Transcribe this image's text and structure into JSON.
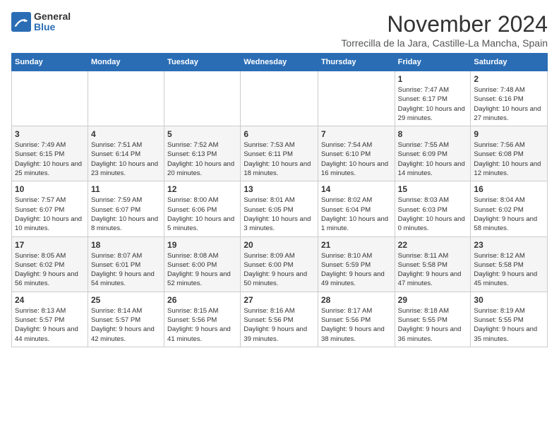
{
  "logo": {
    "general": "General",
    "blue": "Blue"
  },
  "title": "November 2024",
  "subtitle": "Torrecilla de la Jara, Castille-La Mancha, Spain",
  "days_of_week": [
    "Sunday",
    "Monday",
    "Tuesday",
    "Wednesday",
    "Thursday",
    "Friday",
    "Saturday"
  ],
  "weeks": [
    [
      {
        "day": "",
        "info": ""
      },
      {
        "day": "",
        "info": ""
      },
      {
        "day": "",
        "info": ""
      },
      {
        "day": "",
        "info": ""
      },
      {
        "day": "",
        "info": ""
      },
      {
        "day": "1",
        "info": "Sunrise: 7:47 AM\nSunset: 6:17 PM\nDaylight: 10 hours and 29 minutes."
      },
      {
        "day": "2",
        "info": "Sunrise: 7:48 AM\nSunset: 6:16 PM\nDaylight: 10 hours and 27 minutes."
      }
    ],
    [
      {
        "day": "3",
        "info": "Sunrise: 7:49 AM\nSunset: 6:15 PM\nDaylight: 10 hours and 25 minutes."
      },
      {
        "day": "4",
        "info": "Sunrise: 7:51 AM\nSunset: 6:14 PM\nDaylight: 10 hours and 23 minutes."
      },
      {
        "day": "5",
        "info": "Sunrise: 7:52 AM\nSunset: 6:13 PM\nDaylight: 10 hours and 20 minutes."
      },
      {
        "day": "6",
        "info": "Sunrise: 7:53 AM\nSunset: 6:11 PM\nDaylight: 10 hours and 18 minutes."
      },
      {
        "day": "7",
        "info": "Sunrise: 7:54 AM\nSunset: 6:10 PM\nDaylight: 10 hours and 16 minutes."
      },
      {
        "day": "8",
        "info": "Sunrise: 7:55 AM\nSunset: 6:09 PM\nDaylight: 10 hours and 14 minutes."
      },
      {
        "day": "9",
        "info": "Sunrise: 7:56 AM\nSunset: 6:08 PM\nDaylight: 10 hours and 12 minutes."
      }
    ],
    [
      {
        "day": "10",
        "info": "Sunrise: 7:57 AM\nSunset: 6:07 PM\nDaylight: 10 hours and 10 minutes."
      },
      {
        "day": "11",
        "info": "Sunrise: 7:59 AM\nSunset: 6:07 PM\nDaylight: 10 hours and 8 minutes."
      },
      {
        "day": "12",
        "info": "Sunrise: 8:00 AM\nSunset: 6:06 PM\nDaylight: 10 hours and 5 minutes."
      },
      {
        "day": "13",
        "info": "Sunrise: 8:01 AM\nSunset: 6:05 PM\nDaylight: 10 hours and 3 minutes."
      },
      {
        "day": "14",
        "info": "Sunrise: 8:02 AM\nSunset: 6:04 PM\nDaylight: 10 hours and 1 minute."
      },
      {
        "day": "15",
        "info": "Sunrise: 8:03 AM\nSunset: 6:03 PM\nDaylight: 10 hours and 0 minutes."
      },
      {
        "day": "16",
        "info": "Sunrise: 8:04 AM\nSunset: 6:02 PM\nDaylight: 9 hours and 58 minutes."
      }
    ],
    [
      {
        "day": "17",
        "info": "Sunrise: 8:05 AM\nSunset: 6:02 PM\nDaylight: 9 hours and 56 minutes."
      },
      {
        "day": "18",
        "info": "Sunrise: 8:07 AM\nSunset: 6:01 PM\nDaylight: 9 hours and 54 minutes."
      },
      {
        "day": "19",
        "info": "Sunrise: 8:08 AM\nSunset: 6:00 PM\nDaylight: 9 hours and 52 minutes."
      },
      {
        "day": "20",
        "info": "Sunrise: 8:09 AM\nSunset: 6:00 PM\nDaylight: 9 hours and 50 minutes."
      },
      {
        "day": "21",
        "info": "Sunrise: 8:10 AM\nSunset: 5:59 PM\nDaylight: 9 hours and 49 minutes."
      },
      {
        "day": "22",
        "info": "Sunrise: 8:11 AM\nSunset: 5:58 PM\nDaylight: 9 hours and 47 minutes."
      },
      {
        "day": "23",
        "info": "Sunrise: 8:12 AM\nSunset: 5:58 PM\nDaylight: 9 hours and 45 minutes."
      }
    ],
    [
      {
        "day": "24",
        "info": "Sunrise: 8:13 AM\nSunset: 5:57 PM\nDaylight: 9 hours and 44 minutes."
      },
      {
        "day": "25",
        "info": "Sunrise: 8:14 AM\nSunset: 5:57 PM\nDaylight: 9 hours and 42 minutes."
      },
      {
        "day": "26",
        "info": "Sunrise: 8:15 AM\nSunset: 5:56 PM\nDaylight: 9 hours and 41 minutes."
      },
      {
        "day": "27",
        "info": "Sunrise: 8:16 AM\nSunset: 5:56 PM\nDaylight: 9 hours and 39 minutes."
      },
      {
        "day": "28",
        "info": "Sunrise: 8:17 AM\nSunset: 5:56 PM\nDaylight: 9 hours and 38 minutes."
      },
      {
        "day": "29",
        "info": "Sunrise: 8:18 AM\nSunset: 5:55 PM\nDaylight: 9 hours and 36 minutes."
      },
      {
        "day": "30",
        "info": "Sunrise: 8:19 AM\nSunset: 5:55 PM\nDaylight: 9 hours and 35 minutes."
      }
    ]
  ]
}
